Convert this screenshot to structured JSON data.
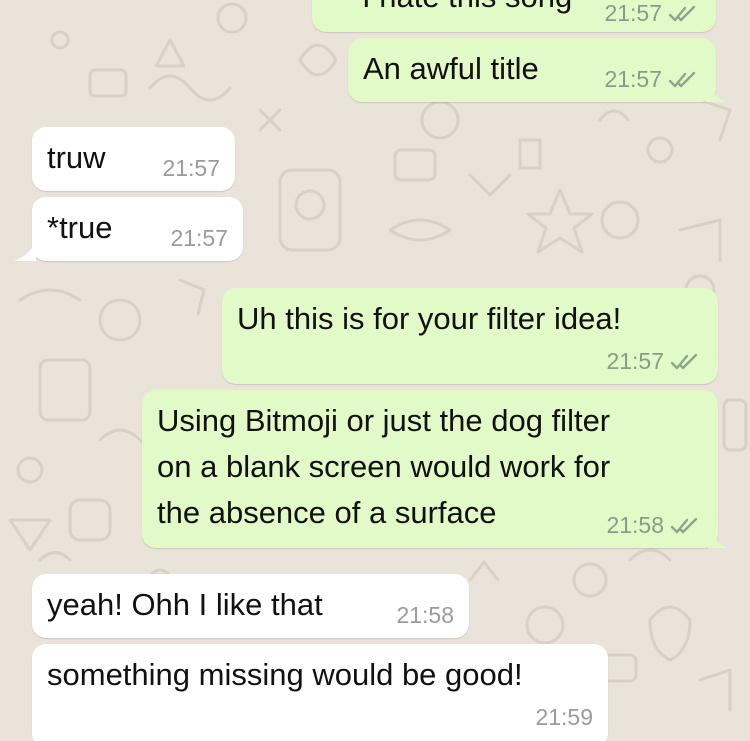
{
  "theme": {
    "background": "#e9e3da",
    "outgoing_bubble": "#e1fac8",
    "incoming_bubble": "#ffffff",
    "tick_color": "#8fa58c"
  },
  "messages": [
    {
      "direction": "outgoing",
      "text": "I hate this song",
      "time": "21:57",
      "status_icon": "double-check-icon"
    },
    {
      "direction": "outgoing",
      "text": "An awful title",
      "time": "21:57",
      "status_icon": "double-check-icon"
    },
    {
      "direction": "incoming",
      "text": "truw",
      "time": "21:57"
    },
    {
      "direction": "incoming",
      "text": "*true",
      "time": "21:57"
    },
    {
      "direction": "outgoing",
      "text": "Uh this is for your filter idea!",
      "time": "21:57",
      "status_icon": "double-check-icon"
    },
    {
      "direction": "outgoing",
      "lines": [
        "Using Bitmoji or just the dog filter",
        "on a blank screen would work for",
        "the absence of a surface"
      ],
      "time": "21:58",
      "status_icon": "double-check-icon"
    },
    {
      "direction": "incoming",
      "text": "yeah! Ohh I like that",
      "time": "21:58"
    },
    {
      "direction": "incoming",
      "text": "something missing would be good!",
      "time": "21:59"
    }
  ]
}
